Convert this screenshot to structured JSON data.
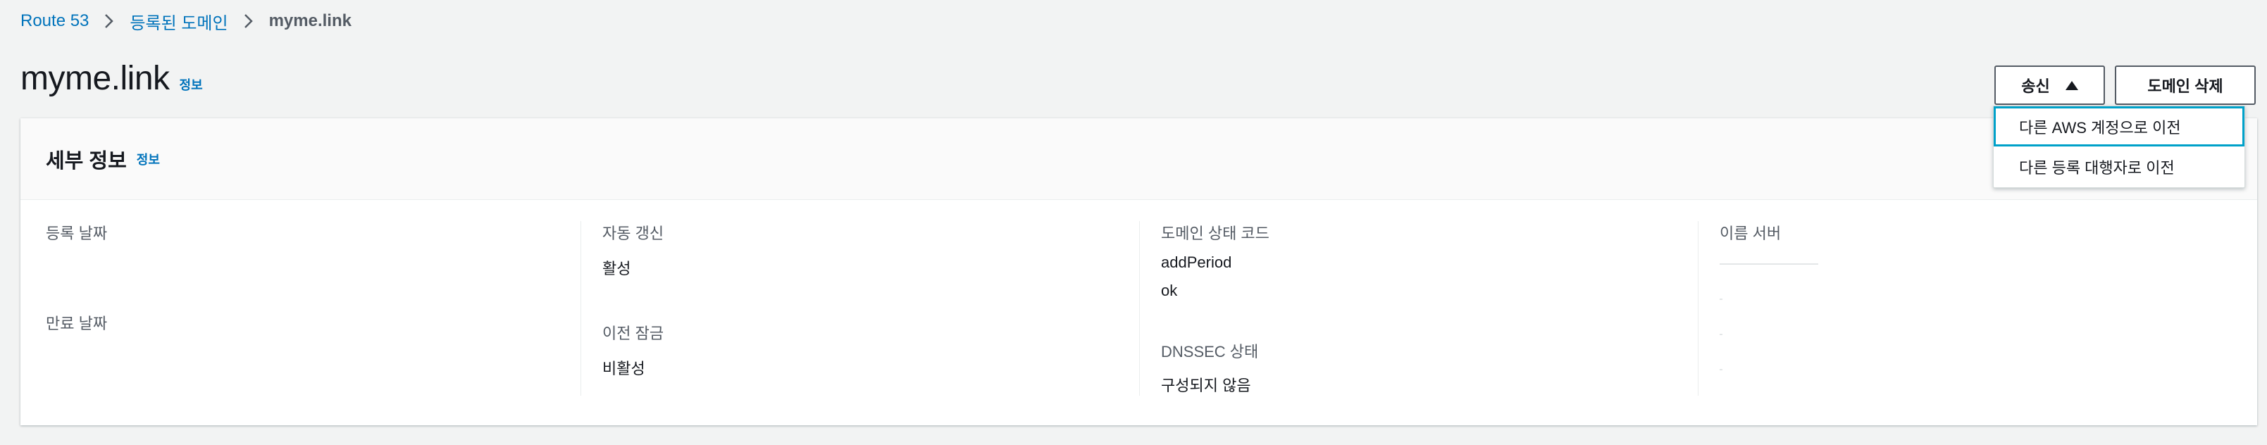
{
  "breadcrumb": {
    "items": [
      "Route 53",
      "등록된 도메인"
    ],
    "current": "myme.link"
  },
  "page": {
    "title": "myme.link",
    "info_label": "정보"
  },
  "actions": {
    "send_label": "송신",
    "delete_label": "도메인 삭제",
    "send_menu": [
      "다른 AWS 계정으로 이전",
      "다른 등록 대행자로 이전"
    ]
  },
  "details": {
    "title": "세부 정보",
    "info_label": "정보",
    "registration_date_label": "등록 날짜",
    "expiration_date_label": "만료 날짜",
    "auto_renew_label": "자동 갱신",
    "auto_renew_value": "활성",
    "transfer_lock_label": "이전 잠금",
    "transfer_lock_value": "비활성",
    "status_code_label": "도메인 상태 코드",
    "status_codes": [
      "addPeriod",
      "ok"
    ],
    "dnssec_label": "DNSSEC 상태",
    "dnssec_value": "구성되지 않음",
    "name_servers_label": "이름 서버"
  }
}
